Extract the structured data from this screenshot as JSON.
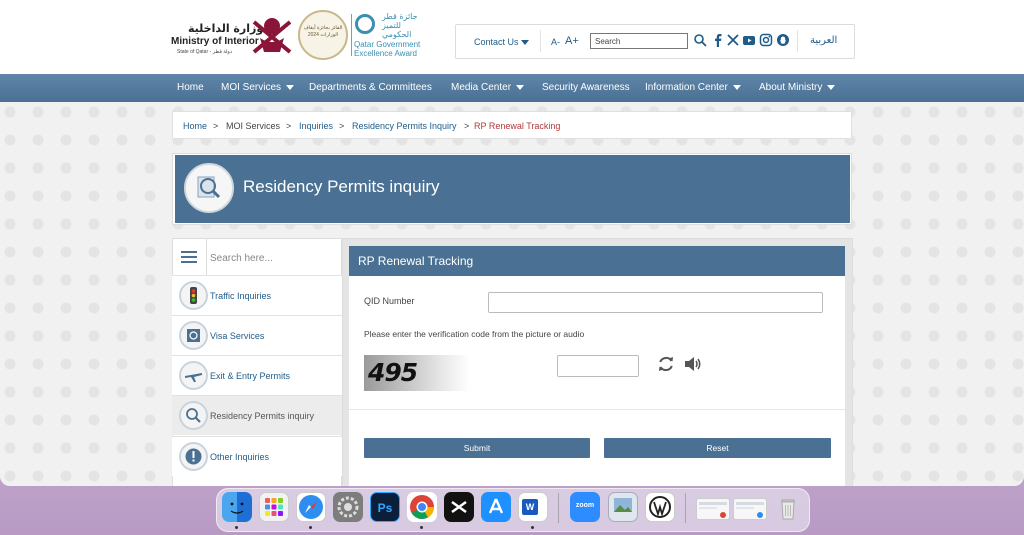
{
  "header": {
    "logo_ar": "وزارة الداخلية",
    "logo_en": "Ministry of Interior",
    "logo_sub": "State of Qatar - دولة قطر",
    "award_badge": "الفائز بجائزة أيقاف الوزارات 2024",
    "qgea_ar": "جائزة قطر للتميز الحكومي",
    "qgea_en_line1": "Qatar Government",
    "qgea_en_line2": "Excellence Award",
    "contact_label": "Contact Us",
    "font_decrease": "A-",
    "font_increase": "A+",
    "search_placeholder": "Search",
    "language_label": "العربية"
  },
  "nav": {
    "home": "Home",
    "moi_services": "MOI Services",
    "departments": "Departments & Committees",
    "media_center": "Media Center",
    "security_awareness": "Security Awareness",
    "information_center": "Information Center",
    "about_ministry": "About Ministry"
  },
  "breadcrumb": {
    "home": "Home",
    "moi_services": "MOI Services",
    "inquiries": "Inquiries",
    "residency_inquiry": "Residency Permits Inquiry",
    "current": "RP Renewal Tracking",
    "separator": ">"
  },
  "banner": {
    "title": "Residency Permits inquiry"
  },
  "sidebar": {
    "search_placeholder": "Search here...",
    "items": [
      {
        "label": "Traffic Inquiries"
      },
      {
        "label": "Visa Services"
      },
      {
        "label": "Exit & Entry Permits"
      },
      {
        "label": "Residency Permits inquiry"
      },
      {
        "label": "Other Inquiries"
      }
    ]
  },
  "form": {
    "title": "RP Renewal Tracking",
    "qid_label": "QID Number",
    "verify_text": "Please enter the verification code from the picture or audio",
    "captcha_text": "495",
    "submit_label": "Submit",
    "reset_label": "Reset"
  },
  "dock": {
    "apps": [
      "Finder",
      "Launchpad",
      "Safari",
      "System Settings",
      "Photoshop",
      "Chrome",
      "CapCut",
      "App Store",
      "Word",
      "Zoom",
      "Preview",
      "WordPress",
      "Window 1",
      "Window 2",
      "Trash"
    ],
    "labels": {
      "photoshop": "Ps",
      "word": "W",
      "zoom": "zoom"
    }
  },
  "colors": {
    "accent": "#4a7193",
    "link": "#1f5c8a",
    "current": "#b03a3a"
  }
}
